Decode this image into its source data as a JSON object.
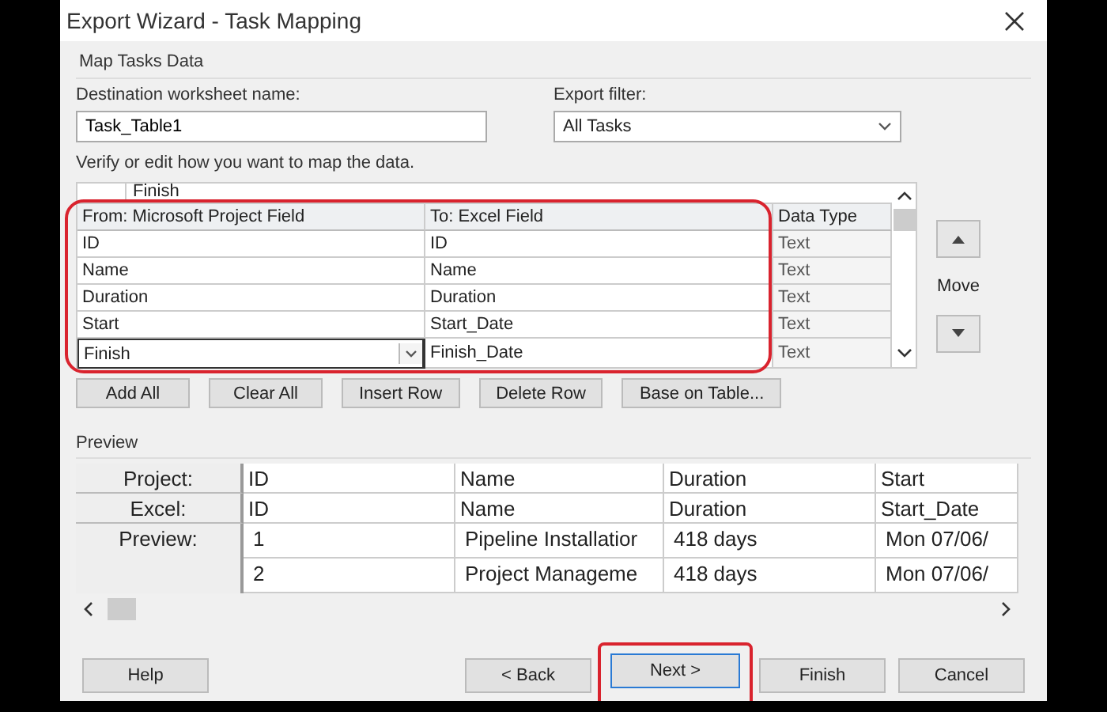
{
  "window": {
    "title": "Export Wizard - Task Mapping"
  },
  "section_title": "Map Tasks Data",
  "destination": {
    "label": "Destination worksheet name:",
    "value": "Task_Table1"
  },
  "export_filter": {
    "label": "Export filter:",
    "value": "All Tasks"
  },
  "instruction": "Verify or edit how you want to map the data.",
  "mapping": {
    "highlighted": true,
    "partial_row": "Finish",
    "columns": [
      "From: Microsoft Project Field",
      "To:  Excel Field",
      "Data Type"
    ],
    "rows": [
      {
        "from": "ID",
        "to": "ID",
        "type": "Text",
        "editing": false
      },
      {
        "from": "Name",
        "to": "Name",
        "type": "Text",
        "editing": false
      },
      {
        "from": "Duration",
        "to": "Duration",
        "type": "Text",
        "editing": false
      },
      {
        "from": "Start",
        "to": "Start_Date",
        "type": "Text",
        "editing": false
      },
      {
        "from": "Finish",
        "to": "Finish_Date",
        "type": "Text",
        "editing": true
      }
    ]
  },
  "move_label": "Move",
  "mapping_buttons": [
    "Add All",
    "Clear All",
    "Insert Row",
    "Delete Row",
    "Base on Table..."
  ],
  "preview": {
    "label": "Preview",
    "row_labels": [
      "Project:",
      "Excel:",
      "Preview:"
    ],
    "columns": [
      {
        "project": "ID",
        "excel": "ID",
        "values": [
          "1",
          "2"
        ]
      },
      {
        "project": "Name",
        "excel": "Name",
        "values": [
          "Pipeline Installatior",
          "Project Manageme"
        ]
      },
      {
        "project": "Duration",
        "excel": "Duration",
        "values": [
          "418 days",
          "418 days"
        ]
      },
      {
        "project": "Start",
        "excel": "Start_Date",
        "values": [
          "Mon 07/06/",
          "Mon 07/06/"
        ]
      }
    ]
  },
  "footer_buttons": [
    {
      "label": "Help",
      "kind": "help",
      "highlighted": false
    },
    {
      "label": "< Back",
      "kind": "nav",
      "highlighted": false
    },
    {
      "label": "Next >",
      "kind": "default",
      "highlighted": true
    },
    {
      "label": "Finish",
      "kind": "nav",
      "highlighted": false
    },
    {
      "label": "Cancel",
      "kind": "nav",
      "highlighted": false
    }
  ]
}
